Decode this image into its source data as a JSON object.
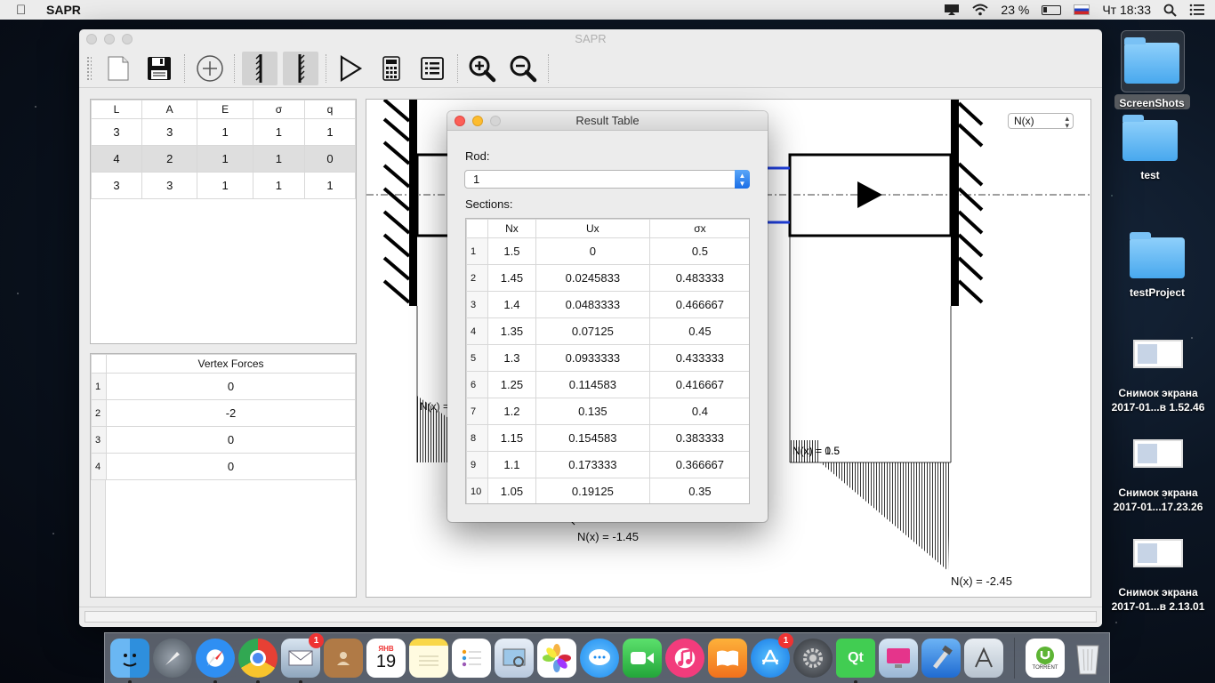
{
  "menubar": {
    "app_name": "SAPR",
    "battery": "23 %",
    "clock": "Чт 18:33"
  },
  "window": {
    "title": "SAPR"
  },
  "toolbar": {
    "tools": [
      "new-file",
      "save",
      "add",
      "left-support",
      "right-support",
      "run",
      "calculator",
      "list",
      "zoom-in",
      "zoom-out"
    ]
  },
  "rods_table": {
    "headers": [
      "L",
      "A",
      "E",
      "σ",
      "q"
    ],
    "rows": [
      [
        "3",
        "3",
        "1",
        "1",
        "1"
      ],
      [
        "4",
        "2",
        "1",
        "1",
        "0"
      ],
      [
        "3",
        "3",
        "1",
        "1",
        "1"
      ]
    ],
    "selected_row": 1
  },
  "vertex_forces": {
    "header": "Vertex Forces",
    "rows": [
      {
        "num": "1",
        "value": "0"
      },
      {
        "num": "2",
        "value": "-2"
      },
      {
        "num": "3",
        "value": "0"
      },
      {
        "num": "4",
        "value": "0"
      }
    ]
  },
  "canvas": {
    "plot_select": "N(x)",
    "labels": {
      "left_value": "N(x) = 1.5",
      "left_value_overlap": "N(x) = 0.5",
      "middle_bottom": "N(x) = -1.45",
      "right_bottom": "N(x) = -2.45"
    }
  },
  "dialog": {
    "title": "Result Table",
    "rod_label": "Rod:",
    "rod_value": "1",
    "sections_label": "Sections:",
    "columns": [
      "Nx",
      "Ux",
      "σx"
    ],
    "rows": [
      [
        "1",
        "1.5",
        "0",
        "0.5"
      ],
      [
        "2",
        "1.45",
        "0.0245833",
        "0.483333"
      ],
      [
        "3",
        "1.4",
        "0.0483333",
        "0.466667"
      ],
      [
        "4",
        "1.35",
        "0.07125",
        "0.45"
      ],
      [
        "5",
        "1.3",
        "0.0933333",
        "0.433333"
      ],
      [
        "6",
        "1.25",
        "0.114583",
        "0.416667"
      ],
      [
        "7",
        "1.2",
        "0.135",
        "0.4"
      ],
      [
        "8",
        "1.15",
        "0.154583",
        "0.383333"
      ],
      [
        "9",
        "1.1",
        "0.173333",
        "0.366667"
      ],
      [
        "10",
        "1.05",
        "0.19125",
        "0.35"
      ]
    ]
  },
  "desktop": {
    "items": [
      {
        "label": "ScreenShots",
        "type": "folder"
      },
      {
        "label": "test",
        "type": "folder"
      },
      {
        "label": "testProject",
        "type": "folder"
      },
      {
        "label": "Снимок экрана 2017-01...в 1.52.46",
        "type": "screenshot"
      },
      {
        "label": "Снимок экрана 2017-01...17.23.26",
        "type": "screenshot"
      },
      {
        "label": "Снимок экрана 2017-01...в 2.13.01",
        "type": "screenshot"
      }
    ]
  },
  "dock": {
    "calendar_month": "ЯНВ",
    "calendar_day": "19",
    "mail_badge": "1",
    "appstore_badge": "1",
    "qt_label": "Qt",
    "torrent_label": "TORRENT"
  },
  "colors": {
    "support_hatch": "#000000",
    "axis_blue": "#1f3fe0",
    "dialog_close": "#fc5f57",
    "dialog_min": "#fdbc2e",
    "combo_blue": "#1a6ee6"
  }
}
